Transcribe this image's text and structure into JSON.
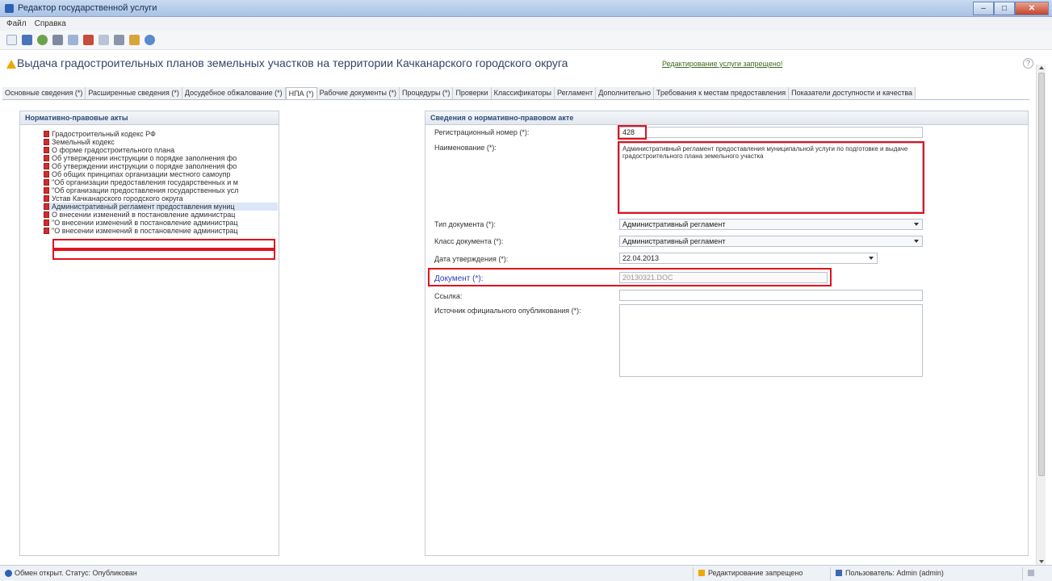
{
  "window": {
    "title": "Редактор государственной услуги"
  },
  "menu": [
    "Файл",
    "Справка"
  ],
  "header": {
    "title": "Выдача градостроительных планов земельных участков на территории Качканарского городского округа",
    "status_link": "Редактирование услуги запрещено!"
  },
  "tabs": [
    "Основные сведения (*)",
    "Расширенные сведения (*)",
    "Досудебное обжалование (*)",
    "НПА (*)",
    "Рабочие документы (*)",
    "Процедуры (*)",
    "Проверки",
    "Классификаторы",
    "Регламент",
    "Дополнительно",
    "Требования к местам предоставления",
    "Показатели доступности и качества"
  ],
  "left_panel": {
    "title": "Нормативно-правовые акты",
    "items": [
      "Градостроительный кодекс РФ",
      "Земельный кодекс",
      "О форме градостроительного плана",
      "Об утверждении инструкции о порядке заполнения фо",
      "Об утверждении инструкции о порядке заполнения фо",
      "Об общих принципах организации местного самоупр",
      "\"Об организации предоставления государственных и м",
      "\"Об организации предоставления государственных усл",
      "Устав Качканарского городского округа",
      "Административный регламент предоставления муниц",
      "О внесении изменений в постановление администрац",
      "\"О внесении изменений в постановление администрац",
      "\"О внесении изменений в постановление администрац"
    ]
  },
  "right_panel": {
    "title": "Сведения о нормативно-правовом акте",
    "reg_number_label": "Регистрационный номер (*):",
    "reg_number": "428",
    "name_label": "Наименование (*):",
    "name_value": "Административный регламент предоставления муниципальной услуги по подготовке и выдаче градостроительного плана земельного участка",
    "doc_type_label": "Тип документа (*):",
    "doc_type": "Административный регламент",
    "doc_class_label": "Класс документа (*):",
    "doc_class": "Административный регламент",
    "approval_date_label": "Дата утверждения (*):",
    "approval_date": "22.04.2013",
    "document_label": "Документ (*):",
    "document_file": "20130321.DOC",
    "link_label": "Ссылка:",
    "link_value": "",
    "source_label": "Источник официального опубликования (*):",
    "source_value": ""
  },
  "status": {
    "left": "Обмен открыт. Статус: Опубликован",
    "mid": "Редактирование запрещено",
    "right": "Пользователь: Admin (admin)"
  }
}
